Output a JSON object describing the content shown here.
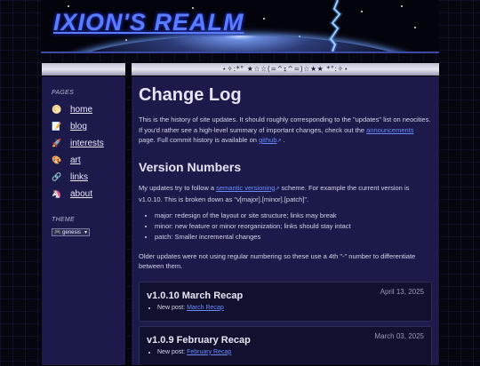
{
  "site_title": "IXION'S REALM",
  "banner": "⋆✧:*° ★☆☆(=^ｪ^=)☆★★ *°:✧⋆",
  "sidebar": {
    "pages_heading": "PAGES",
    "items": [
      {
        "label": "home",
        "icon": "moon-icon",
        "glyph": "🌕"
      },
      {
        "label": "blog",
        "icon": "notepad-icon",
        "glyph": "📝"
      },
      {
        "label": "interests",
        "icon": "rocket-icon",
        "glyph": "🚀"
      },
      {
        "label": "art",
        "icon": "palette-icon",
        "glyph": "🎨"
      },
      {
        "label": "links",
        "icon": "link-icon",
        "glyph": "🔗"
      },
      {
        "label": "about",
        "icon": "unicorn-icon",
        "glyph": "🦄"
      }
    ],
    "theme_heading": "THEME",
    "theme_value": "🎮 genesis"
  },
  "main": {
    "heading": "Change Log",
    "intro_1": "This is the history of site updates. It should roughly corresponding to the \"updates\" list on neocities. If you'd rather see a high-level summary of important changes, check out the",
    "intro_link_1": "announcements",
    "intro_2": "page. Full commit history is available on",
    "intro_link_2": "github",
    "intro_3": ".",
    "version_heading": "Version Numbers",
    "ver_1": "My updates try to follow a",
    "ver_link": "semantic versioning",
    "ver_2": "scheme. For example the current version is v1.0.10. This is broken down as \"v[major].[minor].[patch]\".",
    "bullets": [
      "major: redesign of the layout or site structure; links may break",
      "minor: new feature or minor reorganization; links should stay intact",
      "patch: Smaller incremental changes"
    ],
    "older_note": "Older updates were not using regular numbering so these use a 4th \"-\" number to differentiate between them.",
    "entries": [
      {
        "title": "v1.0.10 March Recap",
        "date": "April 13, 2025",
        "item_prefix": "New post:",
        "item_link": "March Recap"
      },
      {
        "title": "v1.0.9 February Recap",
        "date": "March 03, 2025",
        "item_prefix": "New post:",
        "item_link": "February Recap"
      }
    ]
  }
}
